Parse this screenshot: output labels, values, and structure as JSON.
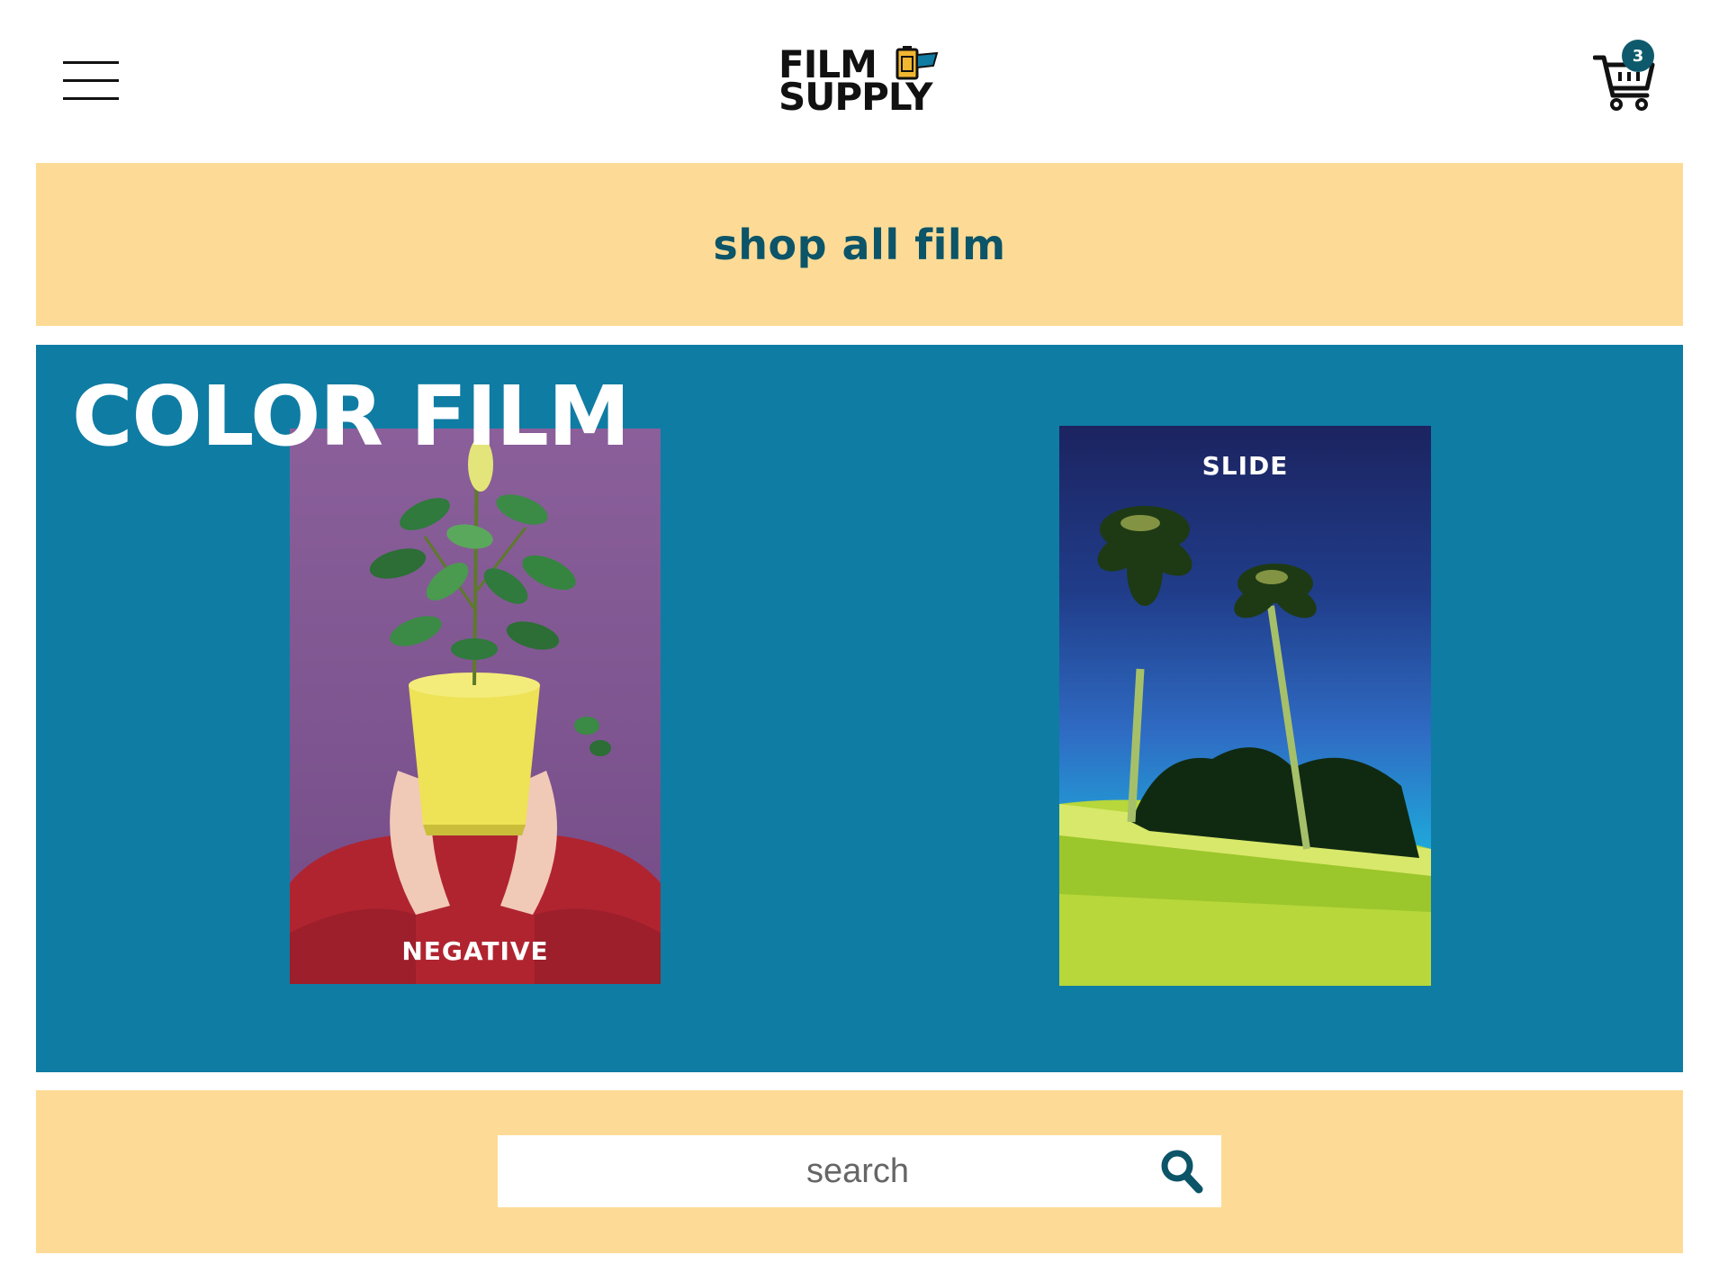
{
  "header": {
    "logo": {
      "line1": "FILM",
      "line2": "SUPPLY"
    },
    "cart": {
      "count": "3"
    }
  },
  "shop_banner": {
    "label": "shop all film"
  },
  "color_section": {
    "title": "COLOR FILM",
    "cards": [
      {
        "label": "NEGATIVE"
      },
      {
        "label": "SLIDE"
      }
    ]
  },
  "search": {
    "placeholder": "search",
    "value": ""
  },
  "colors": {
    "banner_bg": "#fddb96",
    "section_bg": "#0f7ca3",
    "accent_text": "#0c5468",
    "badge_bg": "#0e5a6c"
  },
  "icons": [
    "hamburger-menu-icon",
    "film-canister-icon",
    "cart-icon",
    "search-icon"
  ]
}
